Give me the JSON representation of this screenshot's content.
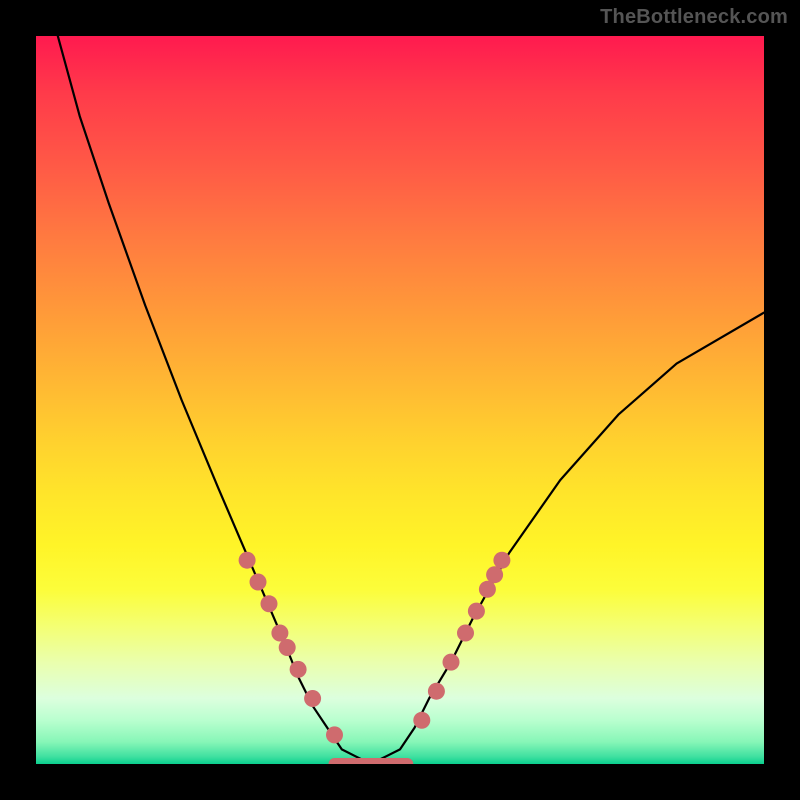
{
  "watermark": "TheBottleneck.com",
  "chart_data": {
    "type": "line",
    "title": "",
    "xlabel": "",
    "ylabel": "",
    "xlim": [
      0,
      100
    ],
    "ylim": [
      0,
      100
    ],
    "grid": false,
    "legend": false,
    "gradient_colors": {
      "top": "#ff1a4f",
      "upper_mid": "#ffb933",
      "lower_mid": "#fff428",
      "bottom": "#0acf8e"
    },
    "series": [
      {
        "name": "bottleneck-v-curve",
        "x": [
          3,
          6,
          10,
          15,
          20,
          25,
          28,
          31,
          34,
          36,
          38,
          40,
          42,
          44,
          46,
          48,
          50,
          52,
          54,
          57,
          60,
          65,
          72,
          80,
          88,
          100
        ],
        "y": [
          100,
          89,
          77,
          63,
          50,
          38,
          31,
          24,
          17,
          12,
          8,
          5,
          2,
          1,
          0,
          1,
          2,
          5,
          9,
          14,
          20,
          29,
          39,
          48,
          55,
          62
        ]
      }
    ],
    "markers": {
      "name": "highlight-dots",
      "color": "#cf6b6e",
      "x": [
        29,
        30.5,
        32,
        33.5,
        34.5,
        36,
        38,
        41,
        53,
        55,
        57,
        59,
        60.5,
        62,
        63,
        64
      ],
      "y": [
        28,
        25,
        22,
        18,
        16,
        13,
        9,
        4,
        6,
        10,
        14,
        18,
        21,
        24,
        26,
        28
      ]
    },
    "flat_bottom": {
      "color": "#cf6b6e",
      "x_range": [
        41,
        51
      ],
      "y": 0
    }
  }
}
